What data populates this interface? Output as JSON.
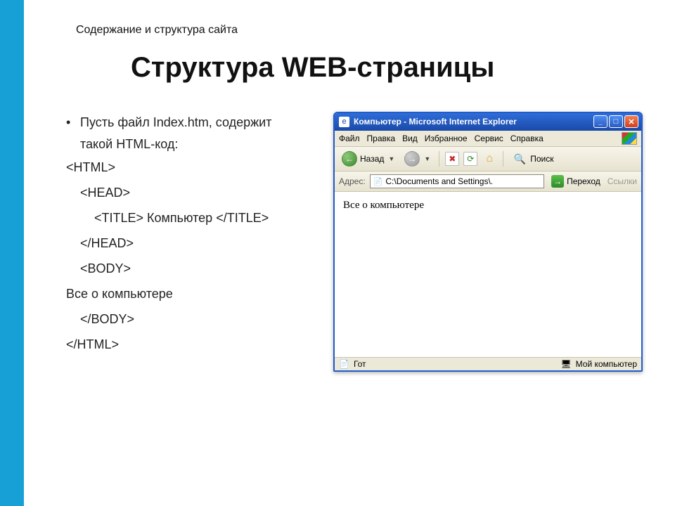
{
  "pre_title": "Содержание и структура сайта",
  "main_title": "Структура WEB-страницы",
  "bullet_text": "Пусть файл Index.htm, содержит такой HTML-код:",
  "code_lines": {
    "l1": "<HTML>",
    "l2": "<HEAD>",
    "l3": "<TITLE> Компьютер </TITLE>",
    "l4": "</HEAD>",
    "l5": "<BODY>",
    "l6": "Все о компьютере",
    "l7": "</BODY>",
    "l8": "</HTML>"
  },
  "ie": {
    "title": "Компьютер - Microsoft Internet Explorer",
    "menu": {
      "file": "Файл",
      "edit": "Правка",
      "view": "Вид",
      "favorites": "Избранное",
      "tools": "Сервис",
      "help": "Справка"
    },
    "toolbar": {
      "back": "Назад",
      "search": "Поиск"
    },
    "address": {
      "label": "Адрес:",
      "value": "C:\\Documents and Settings\\.",
      "go": "Переход",
      "links": "Ссылки"
    },
    "page_body": "Все о компьютере",
    "status": {
      "left": "Гот",
      "right": "Мой компьютер"
    }
  }
}
